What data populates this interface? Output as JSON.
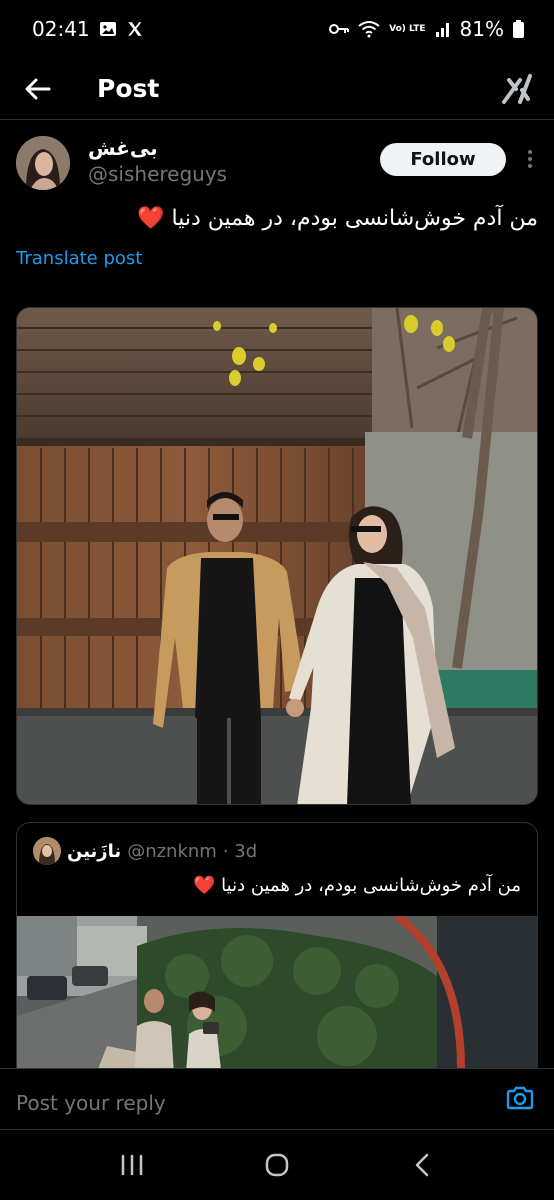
{
  "status_bar": {
    "time": "02:41",
    "battery": "81%",
    "network": "Vo) LTE"
  },
  "header": {
    "title": "Post",
    "back_icon": "arrow-left-icon",
    "grok_icon": "grok-icon"
  },
  "author": {
    "display_name": "بی‌غش",
    "handle": "@sishereguys",
    "follow_label": "Follow"
  },
  "post": {
    "text": "من آدم خوش‌شانسی بودم، در همین دنیا",
    "emoji": "❤️",
    "translate_label": "Translate post"
  },
  "quote": {
    "display_name": "نازَنین",
    "handle": "@nznknm",
    "time": "· 3d",
    "text": "من آدم خوش‌شانسی بودم، در همین دنیا",
    "emoji": "❤️"
  },
  "reply": {
    "placeholder": "Post your reply"
  },
  "colors": {
    "background": "#000000",
    "link": "#1d9bf0",
    "secondary_text": "#71767b",
    "divider": "#2f3336"
  }
}
